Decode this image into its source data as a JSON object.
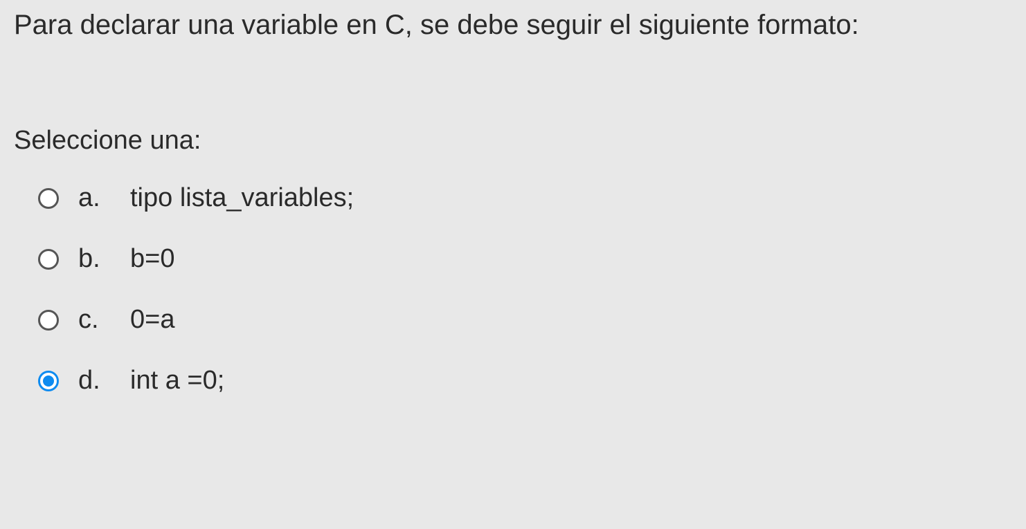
{
  "question": {
    "text": "Para declarar una variable en C, se debe seguir el siguiente formato:",
    "instruction": "Seleccione una:",
    "options": [
      {
        "letter": "a.",
        "text": "tipo lista_variables;",
        "selected": false
      },
      {
        "letter": "b.",
        "text": "b=0",
        "selected": false
      },
      {
        "letter": "c.",
        "text": "0=a",
        "selected": false
      },
      {
        "letter": "d.",
        "text": "int a =0;",
        "selected": true
      }
    ]
  }
}
